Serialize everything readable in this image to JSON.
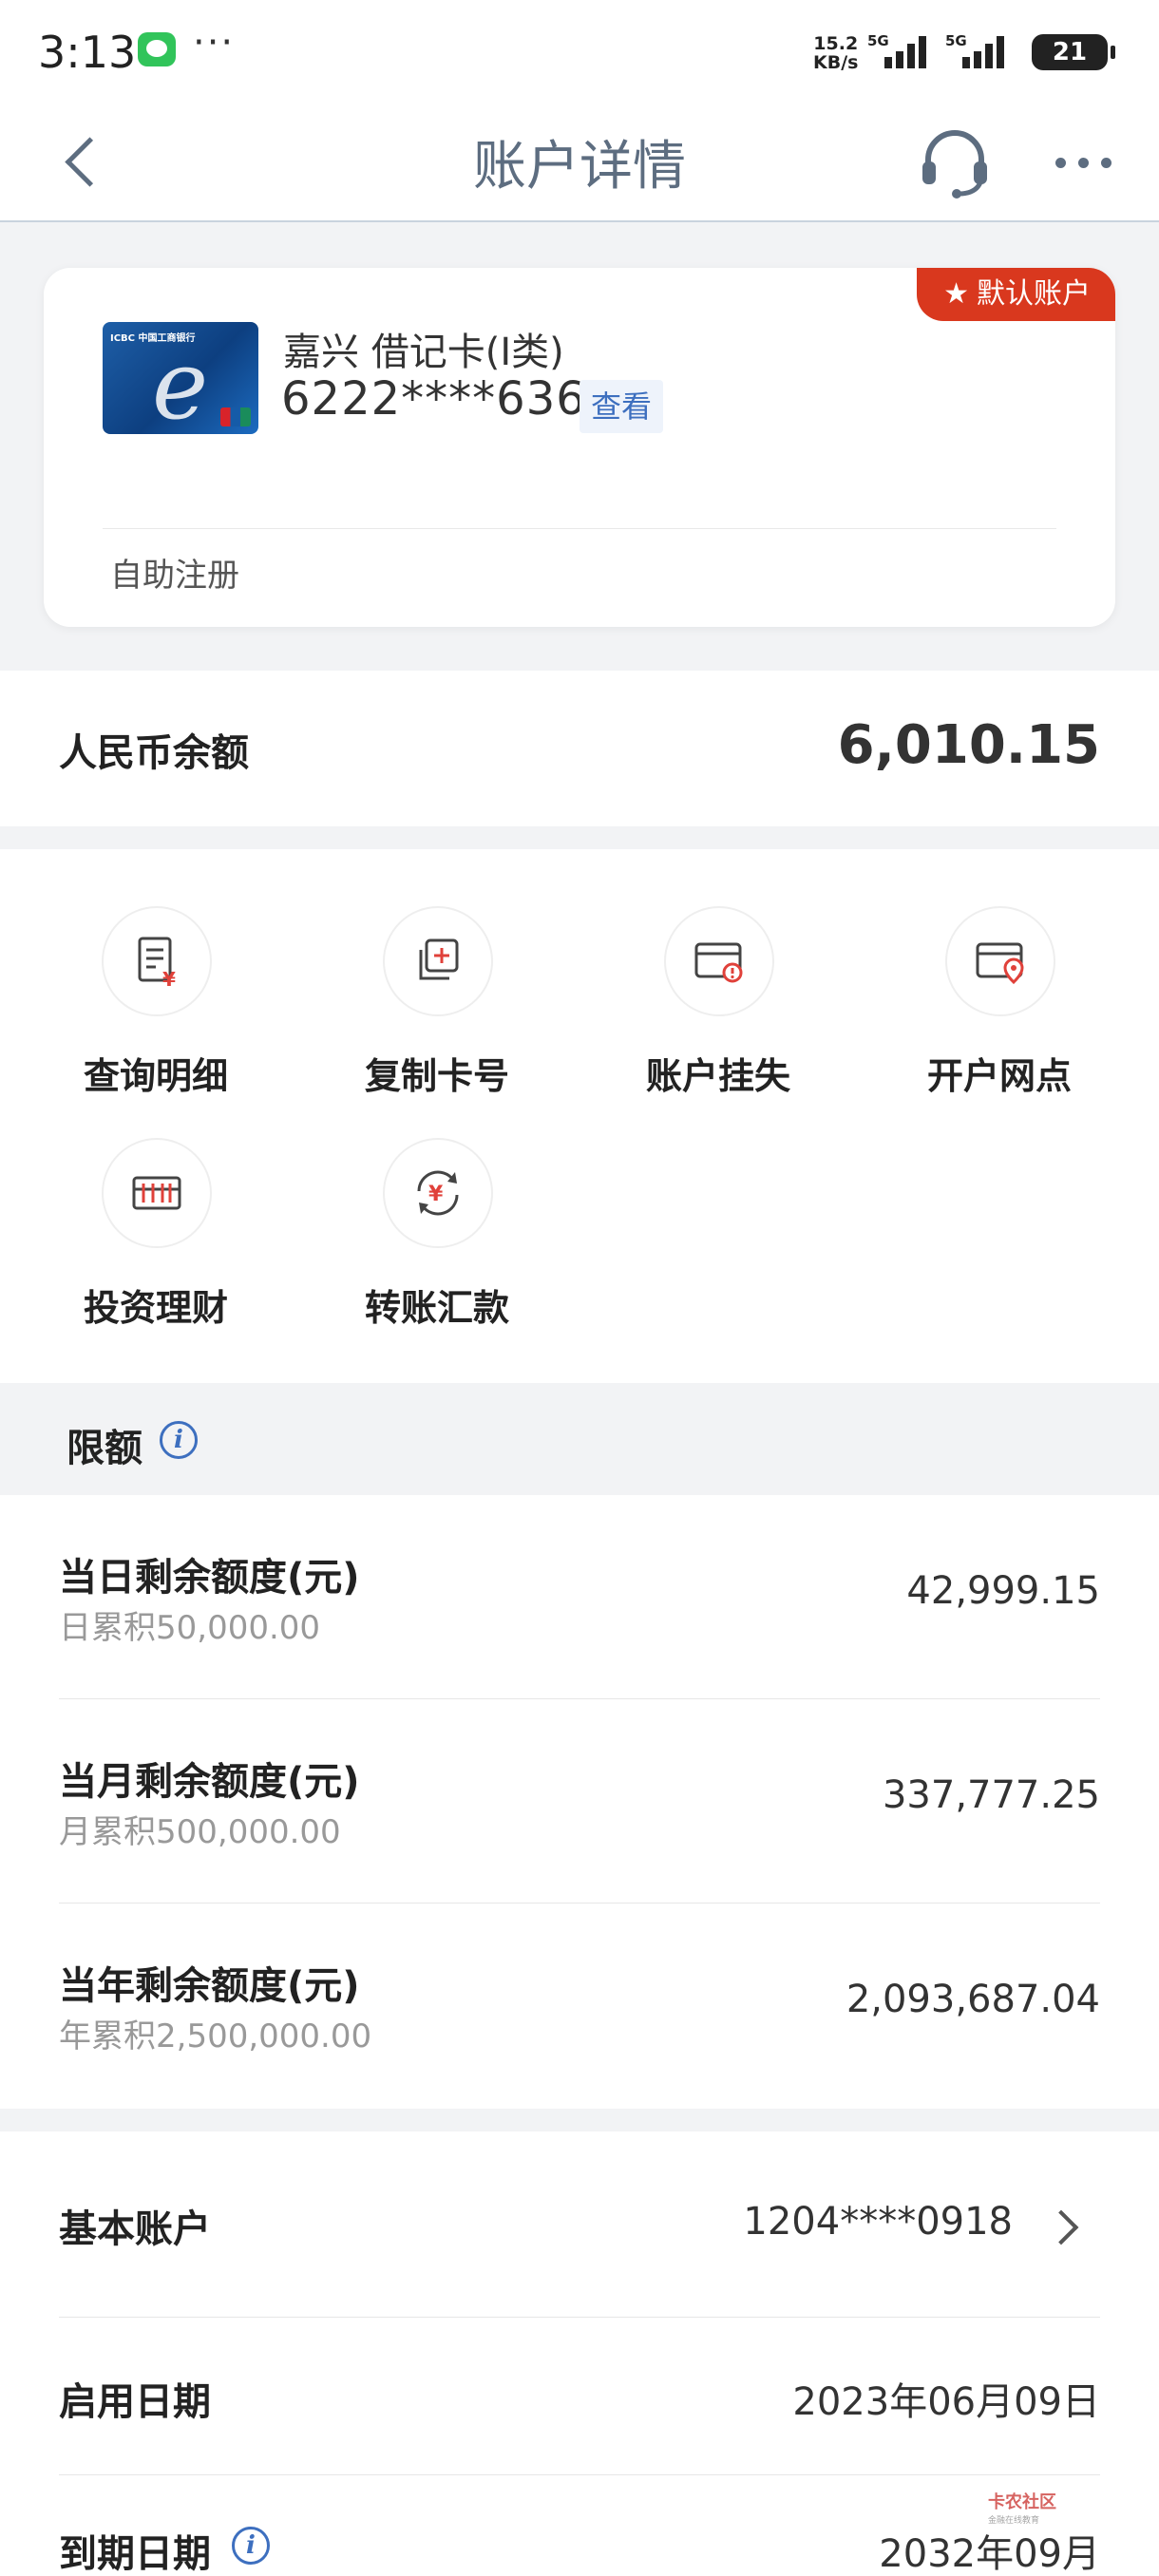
{
  "status_bar": {
    "time": "3:13",
    "dots": "···",
    "net_speed_value": "15.2",
    "net_speed_unit": "KB/s",
    "signal_1": "5G",
    "signal_2": "5G",
    "battery": "21"
  },
  "nav": {
    "title": "账户详情"
  },
  "card": {
    "default_badge": "默认账户",
    "name": "嘉兴 借记卡(I类)",
    "number": "6222****6365",
    "view_label": "查看",
    "note": "自助注册"
  },
  "balance": {
    "label": "人民币余额",
    "value": "6,010.15"
  },
  "actions": [
    {
      "label": "查询明细",
      "icon": "statement-icon"
    },
    {
      "label": "复制卡号",
      "icon": "copy-icon"
    },
    {
      "label": "账户挂失",
      "icon": "card-alert-icon"
    },
    {
      "label": "开户网点",
      "icon": "card-location-icon"
    },
    {
      "label": "投资理财",
      "icon": "abacus-icon"
    },
    {
      "label": "转账汇款",
      "icon": "transfer-icon"
    }
  ],
  "limits": {
    "title": "限额",
    "rows": [
      {
        "title": "当日剩余额度(元)",
        "sub": "日累积50,000.00",
        "value": "42,999.15"
      },
      {
        "title": "当月剩余额度(元)",
        "sub": "月累积500,000.00",
        "value": "337,777.25"
      },
      {
        "title": "当年剩余额度(元)",
        "sub": "年累积2,500,000.00",
        "value": "2,093,687.04"
      }
    ]
  },
  "details": [
    {
      "label": "基本账户",
      "value": "1204****0918"
    },
    {
      "label": "启用日期",
      "value": "2023年06月09日"
    },
    {
      "label": "到期日期",
      "value": "2032年09月"
    }
  ],
  "watermark": {
    "text": "卡农社区",
    "sub": "金融在线教育"
  },
  "colors": {
    "accent_red": "#d9381e",
    "link_blue": "#3d6fbf",
    "nav_gray": "#5d6d80",
    "icon_red": "#e0413a"
  }
}
